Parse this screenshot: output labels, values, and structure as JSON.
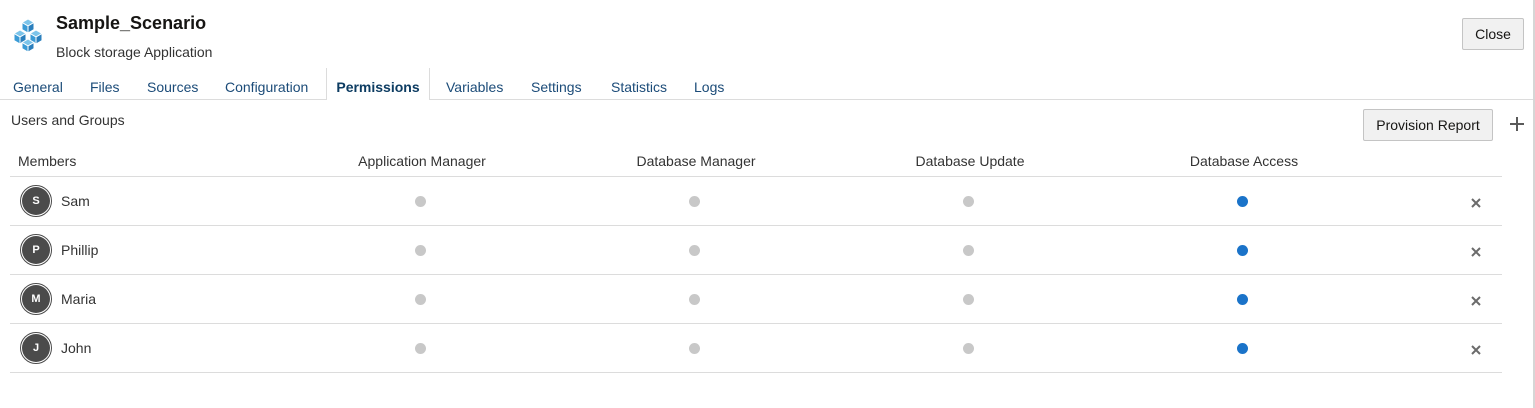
{
  "app": {
    "title": "Sample_Scenario",
    "subtitle": "Block storage Application",
    "logo_icon": "cubes-icon",
    "close_label": "Close"
  },
  "tabs": [
    {
      "label": "General",
      "active": false
    },
    {
      "label": "Files",
      "active": false
    },
    {
      "label": "Sources",
      "active": false
    },
    {
      "label": "Configuration",
      "active": false
    },
    {
      "label": "Permissions",
      "active": true
    },
    {
      "label": "Variables",
      "active": false
    },
    {
      "label": "Settings",
      "active": false
    },
    {
      "label": "Statistics",
      "active": false
    },
    {
      "label": "Logs",
      "active": false
    }
  ],
  "permissions": {
    "section_label": "Users and Groups",
    "provision_report_label": "Provision Report",
    "add_icon": "plus-icon",
    "remove_icon": "close-x-icon",
    "columns": [
      "Members",
      "Application Manager",
      "Database Manager",
      "Database Update",
      "Database Access"
    ],
    "members": [
      {
        "initial": "S",
        "name": "Sam",
        "roles": [
          false,
          false,
          false,
          true
        ]
      },
      {
        "initial": "P",
        "name": "Phillip",
        "roles": [
          false,
          false,
          false,
          true
        ]
      },
      {
        "initial": "M",
        "name": "Maria",
        "roles": [
          false,
          false,
          false,
          true
        ]
      },
      {
        "initial": "J",
        "name": "John",
        "roles": [
          false,
          false,
          false,
          true
        ]
      }
    ]
  },
  "colors": {
    "role_selected": "#1a73c9",
    "role_unselected": "#c8c8c8",
    "link_text": "#1b4b78"
  }
}
